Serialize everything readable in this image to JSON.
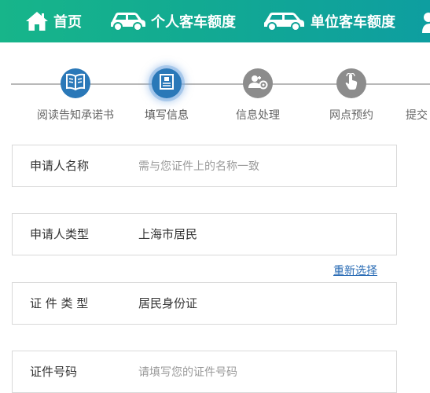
{
  "nav": {
    "items": [
      {
        "label": "首页",
        "icon": "home-icon"
      },
      {
        "label": "个人客车额度",
        "icon": "car-icon"
      },
      {
        "label": "单位客车额度",
        "icon": "car-icon"
      }
    ]
  },
  "steps": [
    {
      "label": "阅读告知承诺书",
      "icon": "book-icon",
      "state": "done"
    },
    {
      "label": "填写信息",
      "icon": "form-icon",
      "state": "active"
    },
    {
      "label": "信息处理",
      "icon": "user-gear-icon",
      "state": "pending"
    },
    {
      "label": "网点预约",
      "icon": "hand-pointer-icon",
      "state": "pending"
    },
    {
      "label": "提交",
      "icon": "",
      "state": "pending"
    }
  ],
  "form": {
    "applicant_name": {
      "label": "申请人名称",
      "value": "",
      "placeholder": "需与您证件上的名称一致"
    },
    "applicant_type": {
      "label": "申请人类型",
      "value": "上海市居民"
    },
    "reselect_link": "重新选择",
    "id_type": {
      "label": "证 件 类 型",
      "value": "居民身份证"
    },
    "id_number": {
      "label": "证件号码",
      "value": "",
      "placeholder": "请填写您的证件号码"
    }
  },
  "colors": {
    "header_gradient_start": "#17b58a",
    "header_gradient_end": "#0e9ea0",
    "step_active": "#2a78b8",
    "step_pending": "#8c8c8c",
    "link": "#2a6cb5"
  }
}
